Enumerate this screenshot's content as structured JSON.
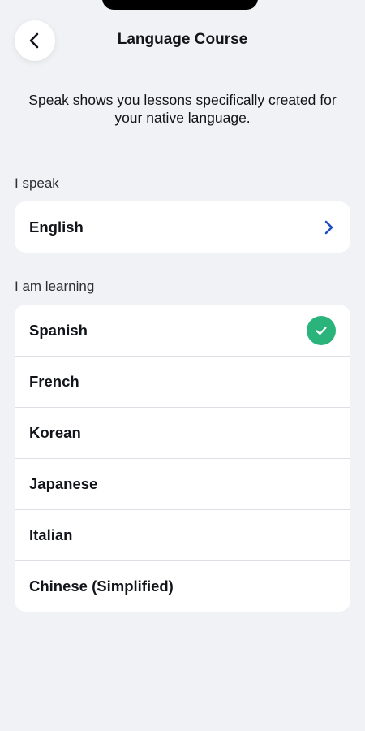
{
  "header": {
    "title": "Language Course"
  },
  "intro": {
    "text": "Speak shows you lessons specifically created for your native language."
  },
  "native": {
    "section_label": "I speak",
    "selected": "English"
  },
  "learning": {
    "section_label": "I am learning",
    "selected": "Spanish",
    "items": [
      {
        "label": "Spanish"
      },
      {
        "label": "French"
      },
      {
        "label": "Korean"
      },
      {
        "label": "Japanese"
      },
      {
        "label": "Italian"
      },
      {
        "label": "Chinese (Simplified)"
      }
    ]
  },
  "colors": {
    "background": "#f0f2f5",
    "card": "#ffffff",
    "accent_check": "#2bb37c",
    "chevron": "#1f4fbf"
  },
  "icons": {
    "back": "chevron-left-icon",
    "native_chevron": "chevron-right-icon",
    "selected_check": "check-circle-icon"
  }
}
